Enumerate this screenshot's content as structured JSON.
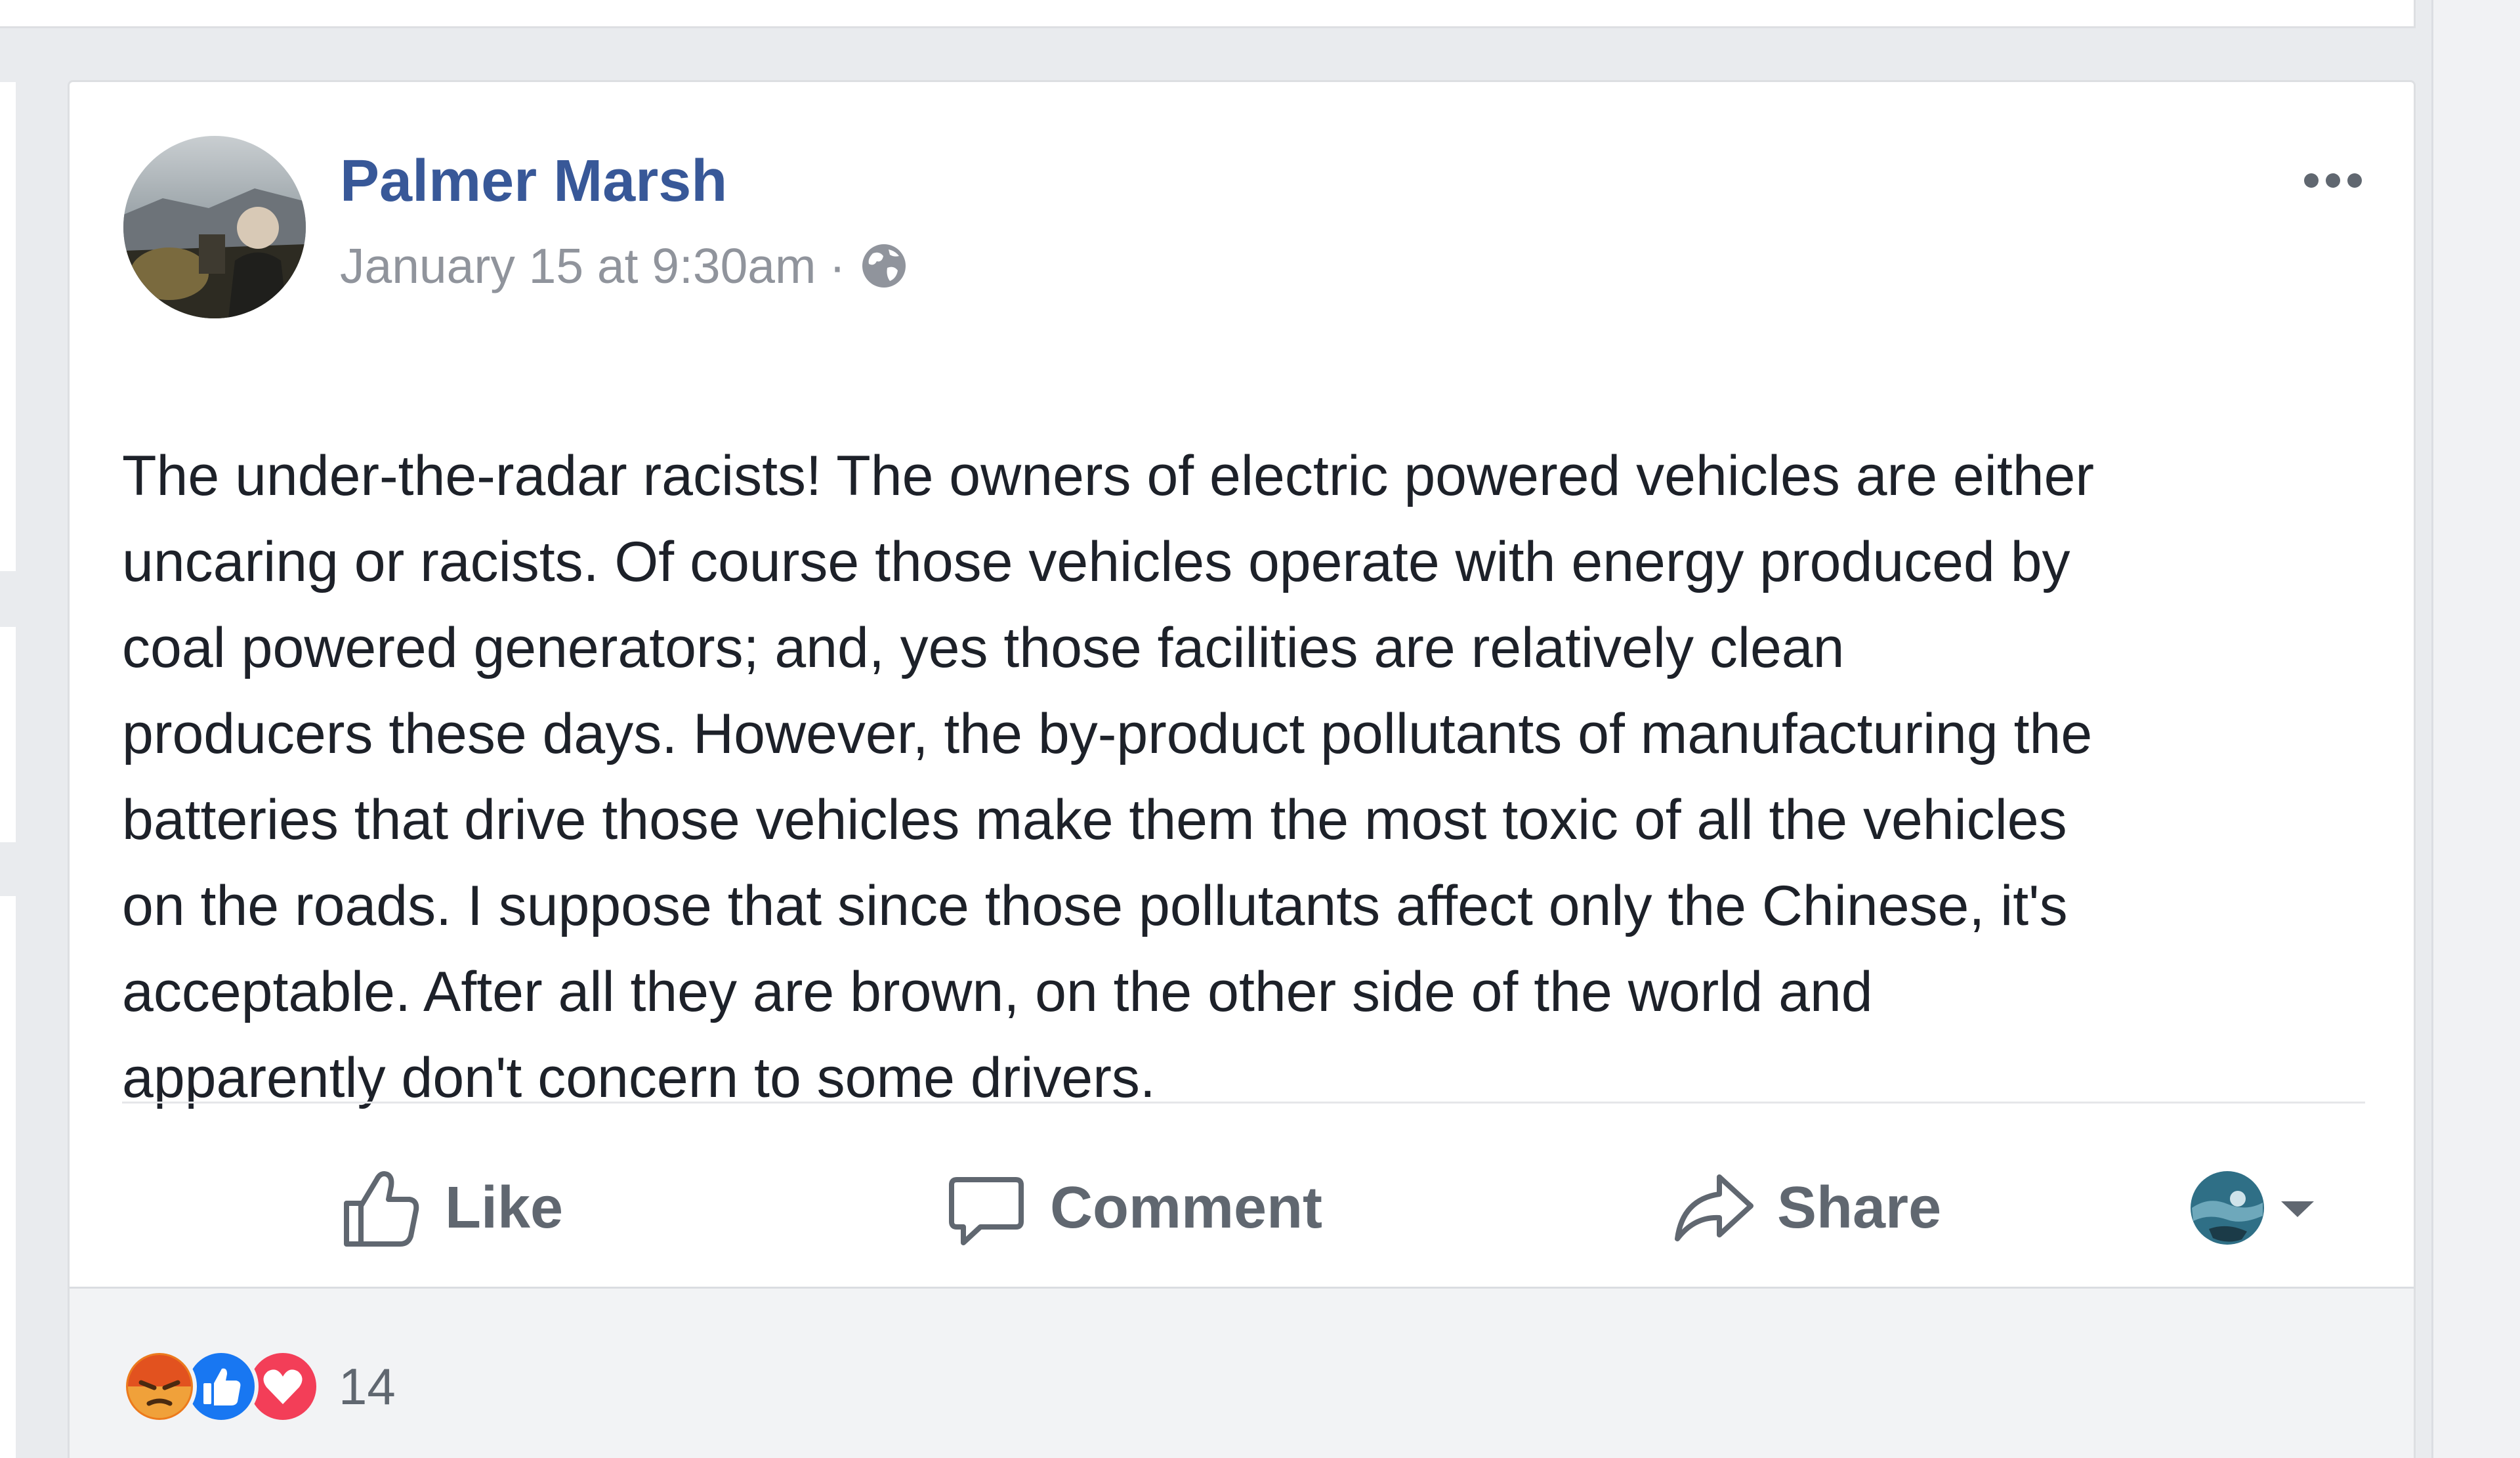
{
  "post": {
    "author": "Palmer Marsh",
    "timestamp": "January 15 at 9:30am",
    "separator": "·",
    "privacy_icon": "globe-icon",
    "text_lines": [
      "The under-the-radar racists! The owners of electric powered vehicles are either",
      "uncaring or racists. Of course those vehicles operate with energy produced by",
      "coal powered generators; and, yes those facilities are relatively clean",
      "producers these days. However, the by-product pollutants of manufacturing the",
      "batteries that drive those vehicles make them the most toxic of all the vehicles",
      "on the roads. I suppose that since those pollutants affect only the Chinese, it's",
      "acceptable. After all they are brown, on the other side of the world and",
      "apparently don't concern to some drivers."
    ]
  },
  "actions": {
    "like": "Like",
    "comment": "Comment",
    "share": "Share"
  },
  "reactions": {
    "types": [
      "angry",
      "like",
      "love"
    ],
    "count": "14"
  },
  "colors": {
    "author_link": "#385898",
    "meta_text": "#90949c",
    "body_text": "#1d2129",
    "action_text": "#606770",
    "like_blue": "#1877f2",
    "love_red": "#f33e58",
    "angry_orange": "#e9710f"
  }
}
